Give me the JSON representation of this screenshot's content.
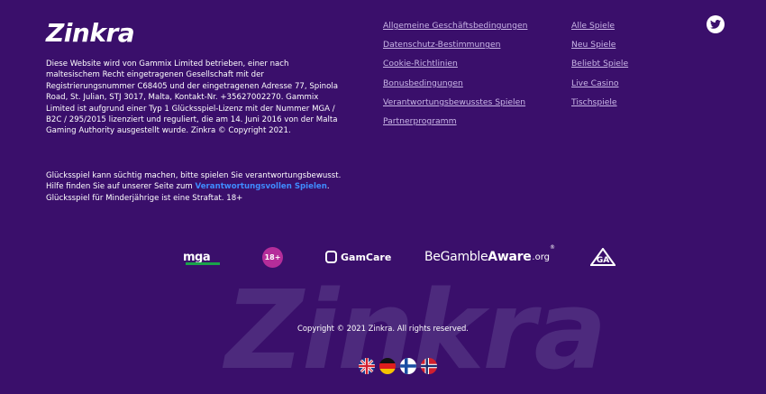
{
  "brand": {
    "name": "Zinkra",
    "watermark": "Zinkra"
  },
  "about": {
    "text": "Diese Website wird von Gammix Limited betrieben, einer nach maltesischem Recht eingetragenen Gesellschaft mit der Registrierungsnummer C68405 und der eingetragenen Adresse 77, Spinola Road, St. Julian, STJ 3017, Malta, Kontakt-Nr. +35627002270. Gammix Limited ist aufgrund einer Typ 1 Glücksspiel-Lizenz mit der Nummer MGA / B2C / 295/2015 lizenziert und reguliert, die am 14. Juni 2016 von der Malta Gaming Authority ausgestellt wurde. Zinkra © Copyright 2021."
  },
  "warning": {
    "before": "Glücksspiel kann süchtig machen, bitte spielen Sie verantwortungsbewusst. Hilfe finden Sie auf unserer Seite zum ",
    "link": "Verantwortungsvollen Spielen",
    "after": ". Glücksspiel für Minderjährige ist eine Straftat. 18+"
  },
  "links_col1": [
    "Allgemeine Geschäftsbedingungen",
    "Datenschutz-Bestimmungen",
    "Cookie-Richtlinien",
    "Bonusbedingungen",
    "Verantwortungsbewusstes Spielen",
    "Partnerprogramm"
  ],
  "links_col2": [
    "Alle Spiele",
    "Neu Spiele",
    "Beliebt Spiele",
    "Live Casino",
    "Tischspiele"
  ],
  "badges": {
    "mga": "mga",
    "age": "18+",
    "gamcare": "GamCare",
    "bga_be": "BeGamble",
    "bga_aware": "Aware",
    "bga_org": ".org",
    "bga_reg": "®"
  },
  "copyright": "Copyright © 2021 Zinkra. All rights reserved.",
  "colors": {
    "background": "#3a0f6b",
    "link": "#c9b6e6",
    "accent_link": "#3f8cff"
  },
  "icons": [
    "twitter-icon",
    "flag-uk-icon",
    "flag-de-icon",
    "flag-fi-icon",
    "flag-no-icon"
  ]
}
